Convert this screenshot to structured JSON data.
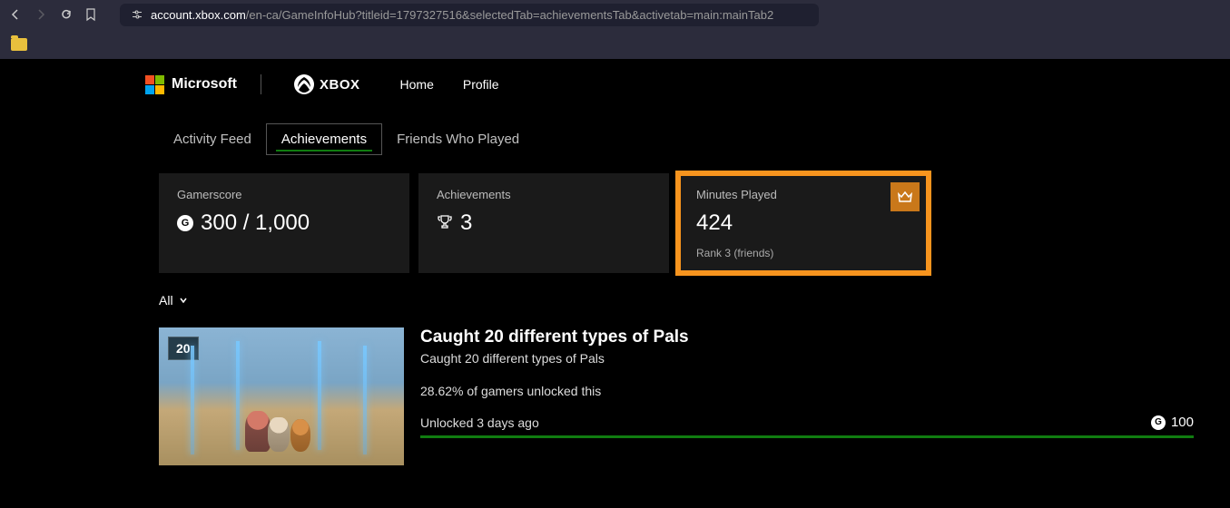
{
  "browser": {
    "url_domain": "account.xbox.com",
    "url_path": "/en-ca/GameInfoHub?titleid=1797327516&selectedTab=achievementsTab&activetab=main:mainTab2"
  },
  "nav": {
    "microsoft": "Microsoft",
    "xbox": "XBOX",
    "home": "Home",
    "profile": "Profile"
  },
  "tabs": {
    "feed": "Activity Feed",
    "achievements": "Achievements",
    "friends": "Friends Who Played"
  },
  "stats": {
    "gamerscore_label": "Gamerscore",
    "gamerscore_value": "300 / 1,000",
    "achievements_label": "Achievements",
    "achievements_value": "3",
    "minutes_label": "Minutes Played",
    "minutes_value": "424",
    "minutes_rank": "Rank 3 (friends)"
  },
  "filter": {
    "all": "All"
  },
  "achievement": {
    "thumb_badge": "20",
    "title": "Caught 20 different types of Pals",
    "desc": "Caught 20 different types of Pals",
    "pct": "28.62% of gamers unlocked this",
    "unlocked": "Unlocked 3 days ago",
    "score": "100"
  }
}
